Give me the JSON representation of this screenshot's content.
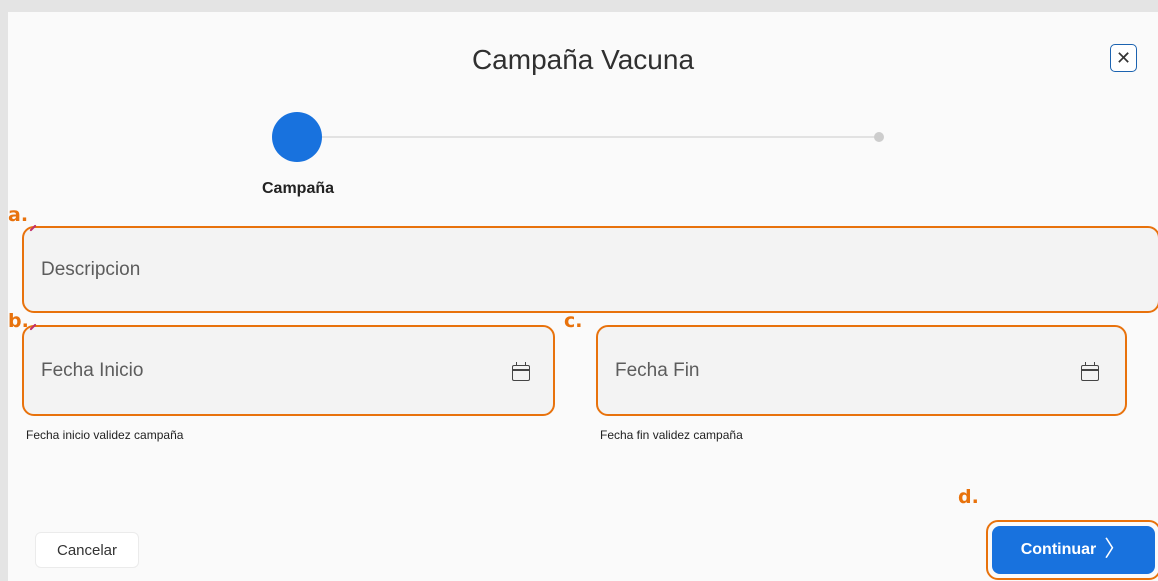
{
  "dialog": {
    "title": "Campaña Vacuna",
    "close_icon": "close-icon"
  },
  "stepper": {
    "steps": [
      {
        "label": "Campaña",
        "state": "active"
      },
      {
        "label": "",
        "state": "pending"
      }
    ],
    "active_color": "#1872de"
  },
  "markers": {
    "a": "a.",
    "b": "b.",
    "c": "c.",
    "d": "d."
  },
  "form": {
    "descripcion": {
      "placeholder": "Descripcion",
      "value": "",
      "required": true
    },
    "fecha_inicio": {
      "placeholder": "Fecha Inicio",
      "value": "",
      "required": true,
      "helper": "Fecha inicio validez campaña",
      "icon": "calendar-icon"
    },
    "fecha_fin": {
      "placeholder": "Fecha Fin",
      "value": "",
      "helper": "Fecha fin validez campaña",
      "icon": "calendar-icon"
    }
  },
  "footer": {
    "cancel_label": "Cancelar",
    "continue_label": "Continuar",
    "continue_icon": "chevron-right-icon"
  },
  "colors": {
    "highlight": "#e8720c",
    "primary": "#1872de",
    "close_border": "#1c63b0"
  }
}
